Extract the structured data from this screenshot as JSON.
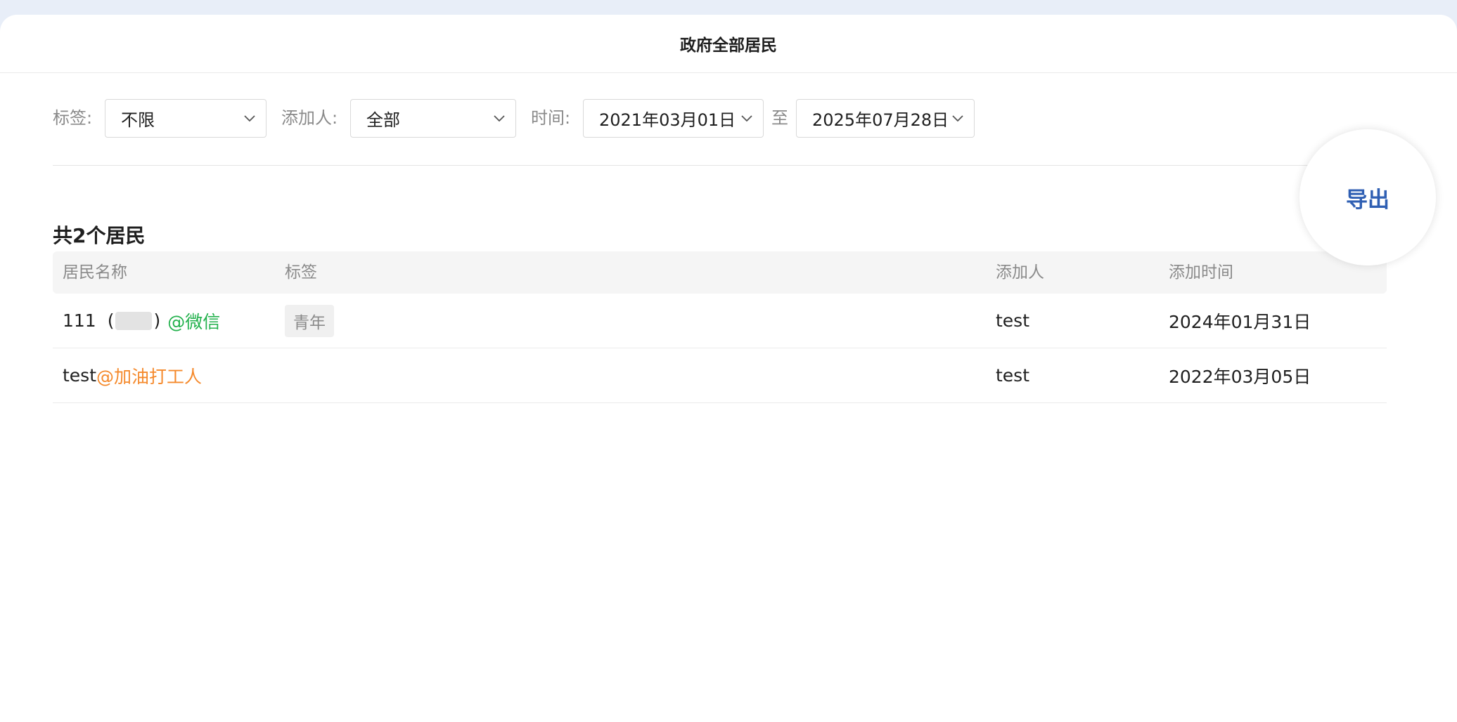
{
  "header": {
    "title": "政府全部居民"
  },
  "filters": {
    "tag": {
      "label": "标签:",
      "value": "不限"
    },
    "adder": {
      "label": "添加人:",
      "value": "全部"
    },
    "time": {
      "label": "时间:",
      "start": "2021年03月01日",
      "to": "至",
      "end": "2025年07月28日"
    }
  },
  "summary": {
    "count_text": "共2个居民"
  },
  "export": {
    "label": "导出"
  },
  "table": {
    "columns": {
      "name": "居民名称",
      "tags": "标签",
      "adder": "添加人",
      "time": "添加时间"
    },
    "rows": [
      {
        "name_prefix": "111",
        "paren_open": "(",
        "paren_close": ")",
        "source": "@微信",
        "tag": "青年",
        "adder": "test",
        "time": "2024年01月31日"
      },
      {
        "name_prefix": "test",
        "source": "@加油打工人",
        "adder": "test",
        "time": "2022年03月05日"
      }
    ]
  },
  "colors": {
    "wechat": "#22b14c",
    "org": "#f5892b",
    "accent": "#2f5fb3"
  }
}
